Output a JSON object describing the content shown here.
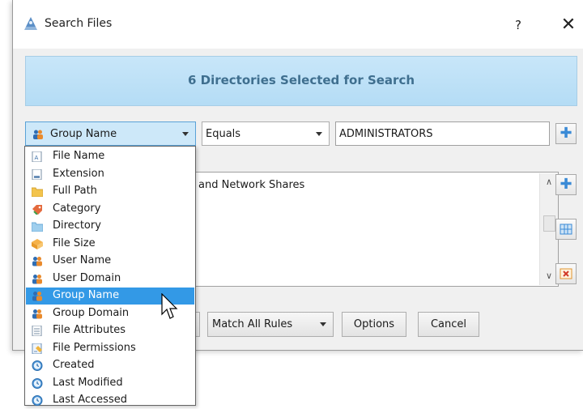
{
  "window": {
    "title": "Search Files",
    "help": "?",
    "close": "✕"
  },
  "banner": {
    "text": "6 Directories Selected for Search"
  },
  "rule": {
    "field": "Group Name",
    "operator": "Equals",
    "value": "ADMINISTRATORS"
  },
  "directories": {
    "visible_text": "and Network Shares"
  },
  "footer": {
    "match_mode": "Match All Rules",
    "options_label": "Options",
    "cancel_label": "Cancel"
  },
  "dropdown": {
    "items": [
      {
        "label": "File Name",
        "icon": "file-name-icon"
      },
      {
        "label": "Extension",
        "icon": "extension-icon"
      },
      {
        "label": "Full Path",
        "icon": "folder-icon"
      },
      {
        "label": "Category",
        "icon": "category-icon"
      },
      {
        "label": "Directory",
        "icon": "directory-icon"
      },
      {
        "label": "File Size",
        "icon": "file-size-icon"
      },
      {
        "label": "User Name",
        "icon": "user-icon"
      },
      {
        "label": "User Domain",
        "icon": "user-icon"
      },
      {
        "label": "Group Name",
        "icon": "group-icon"
      },
      {
        "label": "Group Domain",
        "icon": "group-icon"
      },
      {
        "label": "File Attributes",
        "icon": "attributes-icon"
      },
      {
        "label": "File Permissions",
        "icon": "permissions-icon"
      },
      {
        "label": "Created",
        "icon": "clock-icon"
      },
      {
        "label": "Last Modified",
        "icon": "clock-icon"
      },
      {
        "label": "Last Accessed",
        "icon": "clock-icon"
      }
    ],
    "selected": "Group Name"
  },
  "colors": {
    "accent": "#3399e6",
    "banner": "#c8e6f9",
    "banner_text": "#3f6f8f"
  }
}
